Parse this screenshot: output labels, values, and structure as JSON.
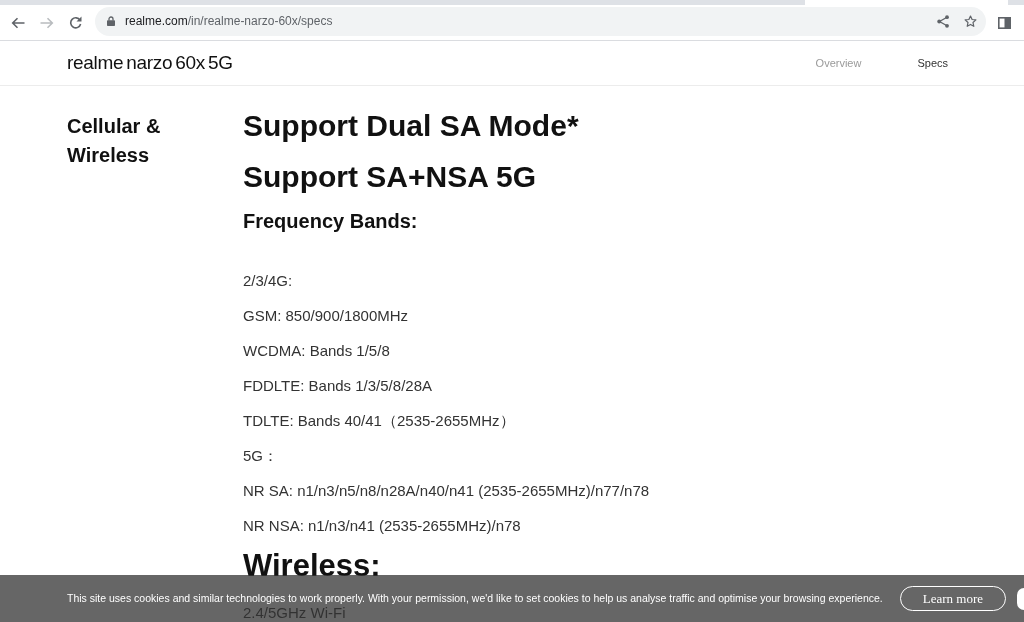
{
  "browser": {
    "nav_buttons": [
      {
        "kind": "back",
        "disabled": false
      },
      {
        "kind": "forward",
        "disabled": true
      },
      {
        "kind": "reload",
        "disabled": false
      }
    ],
    "address": {
      "host": "realme.com",
      "path": "/in/realme-narzo-60x/specs"
    },
    "address_actions": [
      {
        "kind": "share"
      },
      {
        "kind": "bookmark"
      }
    ],
    "toolbar_actions": [
      {
        "kind": "side_panel"
      }
    ]
  },
  "site_header": {
    "logo": "realme narzo 60x 5G",
    "nav": [
      {
        "label": "Overview",
        "selected": false
      },
      {
        "label": "Specs",
        "selected": true
      }
    ]
  },
  "spec_section": {
    "title": "Cellular & Wireless",
    "blocks": [
      {
        "kind": "heading",
        "text": "Support Dual SA Mode*"
      },
      {
        "kind": "heading",
        "text": "Support SA+NSA 5G"
      },
      {
        "kind": "subheading",
        "text": "Frequency Bands:"
      },
      {
        "kind": "line",
        "text": "2/3/4G:"
      },
      {
        "kind": "line",
        "text": "GSM: 850/900/1800MHz"
      },
      {
        "kind": "line",
        "text": "WCDMA: Bands 1/5/8"
      },
      {
        "kind": "line",
        "text": "FDDLTE: Bands 1/3/5/8/28A"
      },
      {
        "kind": "line",
        "text": "TDLTE: Bands 40/41（2535-2655MHz）"
      },
      {
        "kind": "line",
        "text": "5G："
      },
      {
        "kind": "line",
        "text": "NR SA: n1/n3/n5/n8/n28A/n40/n41 (2535-2655MHz)/n77/n78"
      },
      {
        "kind": "line",
        "text": "NR NSA: n1/n3/n41 (2535-2655MHz)/n78"
      },
      {
        "kind": "section",
        "text": "Wireless:"
      },
      {
        "kind": "line",
        "text": "2.4/5GHz Wi-Fi"
      }
    ]
  },
  "cookie_banner": {
    "text": "This site uses cookies and similar technologies to work properly. With your permission, we'd like to set cookies to help us analyse traffic and optimise your browsing experience.",
    "buttons": [
      {
        "kind": "outline",
        "label": "Learn more"
      },
      {
        "kind": "round"
      }
    ]
  }
}
